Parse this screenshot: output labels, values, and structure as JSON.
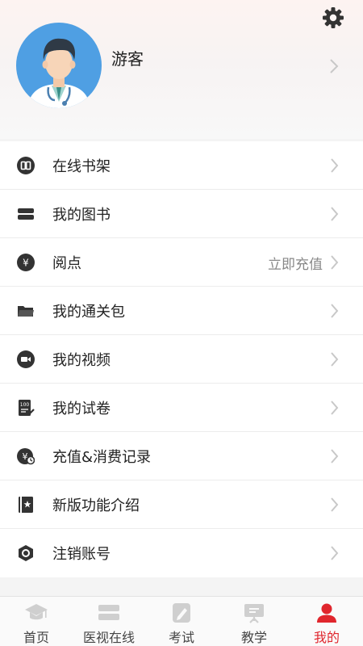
{
  "profile": {
    "username": "游客"
  },
  "menu": {
    "items": [
      {
        "label": "在线书架",
        "icon": "book-open-icon",
        "extra": ""
      },
      {
        "label": "我的图书",
        "icon": "books-stack-icon",
        "extra": ""
      },
      {
        "label": "阅点",
        "icon": "yen-coin-icon",
        "extra": "立即充值"
      },
      {
        "label": "我的通关包",
        "icon": "folder-icon",
        "extra": ""
      },
      {
        "label": "我的视频",
        "icon": "video-camera-icon",
        "extra": ""
      },
      {
        "label": "我的试卷",
        "icon": "test-paper-icon",
        "extra": ""
      },
      {
        "label": "充值&消费记录",
        "icon": "recharge-record-icon",
        "extra": ""
      },
      {
        "label": "新版功能介绍",
        "icon": "new-feature-icon",
        "extra": ""
      },
      {
        "label": "注销账号",
        "icon": "hexagon-cancel-icon",
        "extra": ""
      }
    ]
  },
  "tabbar": {
    "tabs": [
      {
        "label": "首页",
        "icon": "graduation-cap-icon",
        "active": false
      },
      {
        "label": "医视在线",
        "icon": "books-icon",
        "active": false
      },
      {
        "label": "考试",
        "icon": "pencil-note-icon",
        "active": false
      },
      {
        "label": "教学",
        "icon": "teaching-board-icon",
        "active": false
      },
      {
        "label": "我的",
        "icon": "user-icon",
        "active": true
      }
    ]
  },
  "colors": {
    "accent": "#e0262d",
    "avatar_bg": "#4f9fe3",
    "icon_dark": "#333333",
    "inactive_tab_icon": "#cfcfcf"
  }
}
